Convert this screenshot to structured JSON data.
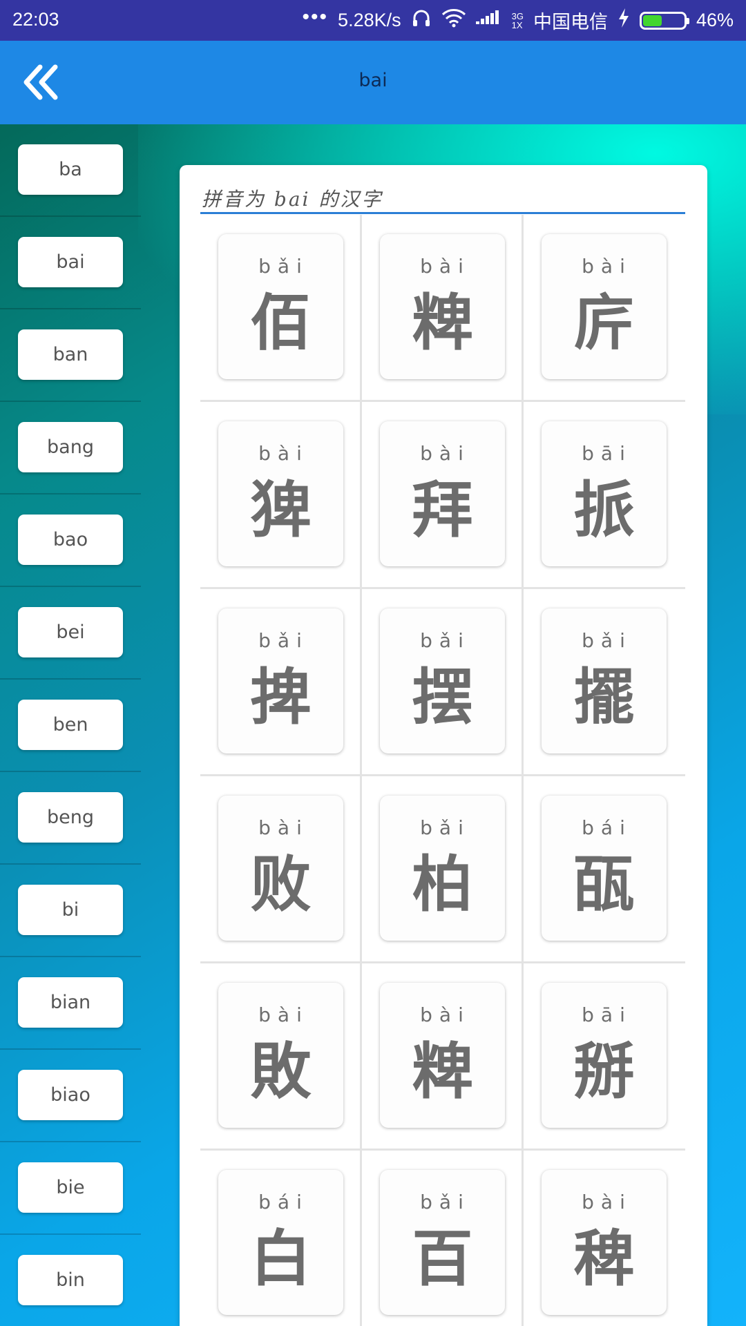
{
  "status_bar": {
    "time": "22:03",
    "dots": "•••",
    "speed": "5.28K/s",
    "net_top": "3G",
    "net_bottom": "1X",
    "carrier": "中国电信",
    "battery_percent": "46%",
    "battery_level": 0.46
  },
  "app_bar": {
    "back_icon": "double-chevron-left-icon",
    "title": "bai"
  },
  "sidebar": {
    "items": [
      {
        "label": "ba"
      },
      {
        "label": "bai"
      },
      {
        "label": "ban"
      },
      {
        "label": "bang"
      },
      {
        "label": "bao"
      },
      {
        "label": "bei"
      },
      {
        "label": "ben"
      },
      {
        "label": "beng"
      },
      {
        "label": "bi"
      },
      {
        "label": "bian"
      },
      {
        "label": "biao"
      },
      {
        "label": "bie"
      },
      {
        "label": "bin"
      }
    ]
  },
  "panel": {
    "title": "拼音为 bai 的汉字",
    "characters": [
      {
        "pinyin": "bǎi",
        "hanzi": "佰"
      },
      {
        "pinyin": "bài",
        "hanzi": "粺"
      },
      {
        "pinyin": "bài",
        "hanzi": "庍"
      },
      {
        "pinyin": "bài",
        "hanzi": "猈"
      },
      {
        "pinyin": "bài",
        "hanzi": "拜"
      },
      {
        "pinyin": "bāi",
        "hanzi": "挀"
      },
      {
        "pinyin": "bǎi",
        "hanzi": "捭"
      },
      {
        "pinyin": "bǎi",
        "hanzi": "摆"
      },
      {
        "pinyin": "bǎi",
        "hanzi": "擺"
      },
      {
        "pinyin": "bài",
        "hanzi": "败"
      },
      {
        "pinyin": "bǎi",
        "hanzi": "柏"
      },
      {
        "pinyin": "bái",
        "hanzi": "㼣"
      },
      {
        "pinyin": "bài",
        "hanzi": "敗"
      },
      {
        "pinyin": "bài",
        "hanzi": "粺"
      },
      {
        "pinyin": "bāi",
        "hanzi": "掰"
      },
      {
        "pinyin": "bái",
        "hanzi": "白"
      },
      {
        "pinyin": "bǎi",
        "hanzi": "百"
      },
      {
        "pinyin": "bài",
        "hanzi": "稗"
      }
    ]
  }
}
